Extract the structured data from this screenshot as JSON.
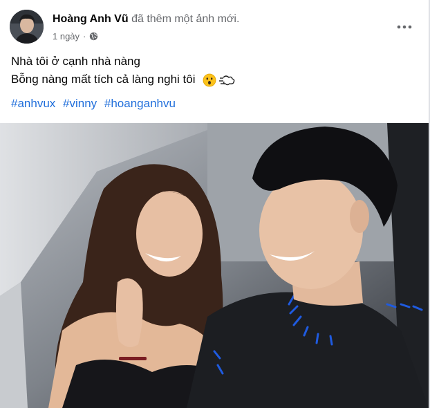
{
  "post": {
    "author": "Hoàng Anh Vũ",
    "action": "đã thêm một ảnh mới.",
    "time": "1 ngày",
    "separator": "·",
    "audience_icon": "globe-icon",
    "more_icon": "more-options-icon",
    "text_lines": [
      "Nhà tôi ở cạnh nhà nàng",
      "Bỗng nàng mất tích cả làng nghi tôi"
    ],
    "emojis": [
      "surprised-face-emoji",
      "dashing-away-emoji"
    ],
    "hashtags": [
      "#anhvux",
      "#vinny",
      "#hoanganhvu"
    ],
    "colors": {
      "hashtag": "#216fdb",
      "secondary_text": "#65676b",
      "primary_text": "#050505"
    }
  }
}
